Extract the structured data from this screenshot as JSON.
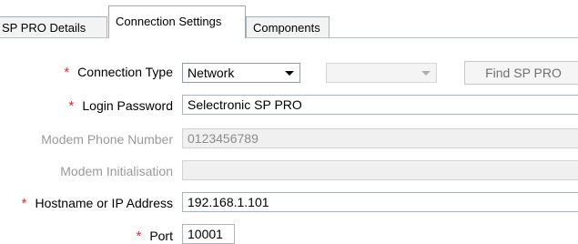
{
  "tabs": [
    {
      "label": "SP PRO Details",
      "active": false
    },
    {
      "label": "Connection Settings",
      "active": true
    },
    {
      "label": "Components",
      "active": false
    }
  ],
  "required_marker": "*",
  "form": {
    "connection_type": {
      "label": "Connection Type",
      "value": "Network",
      "required": true
    },
    "secondary_select": {
      "value": "",
      "disabled": true
    },
    "find_button": {
      "label": "Find SP PRO",
      "disabled": true
    },
    "login_password": {
      "label": "Login Password",
      "value": "Selectronic SP PRO",
      "required": true
    },
    "modem_phone": {
      "label": "Modem Phone Number",
      "value": "0123456789",
      "disabled": true
    },
    "modem_init": {
      "label": "Modem Initialisation",
      "value": "",
      "disabled": true
    },
    "hostname": {
      "label": "Hostname or IP Address",
      "value": "192.168.1.101",
      "required": true
    },
    "port": {
      "label": "Port",
      "value": "10001",
      "required": true
    }
  },
  "colors": {
    "required_star": "#d4343c",
    "disabled_text": "#9a9a9a"
  }
}
